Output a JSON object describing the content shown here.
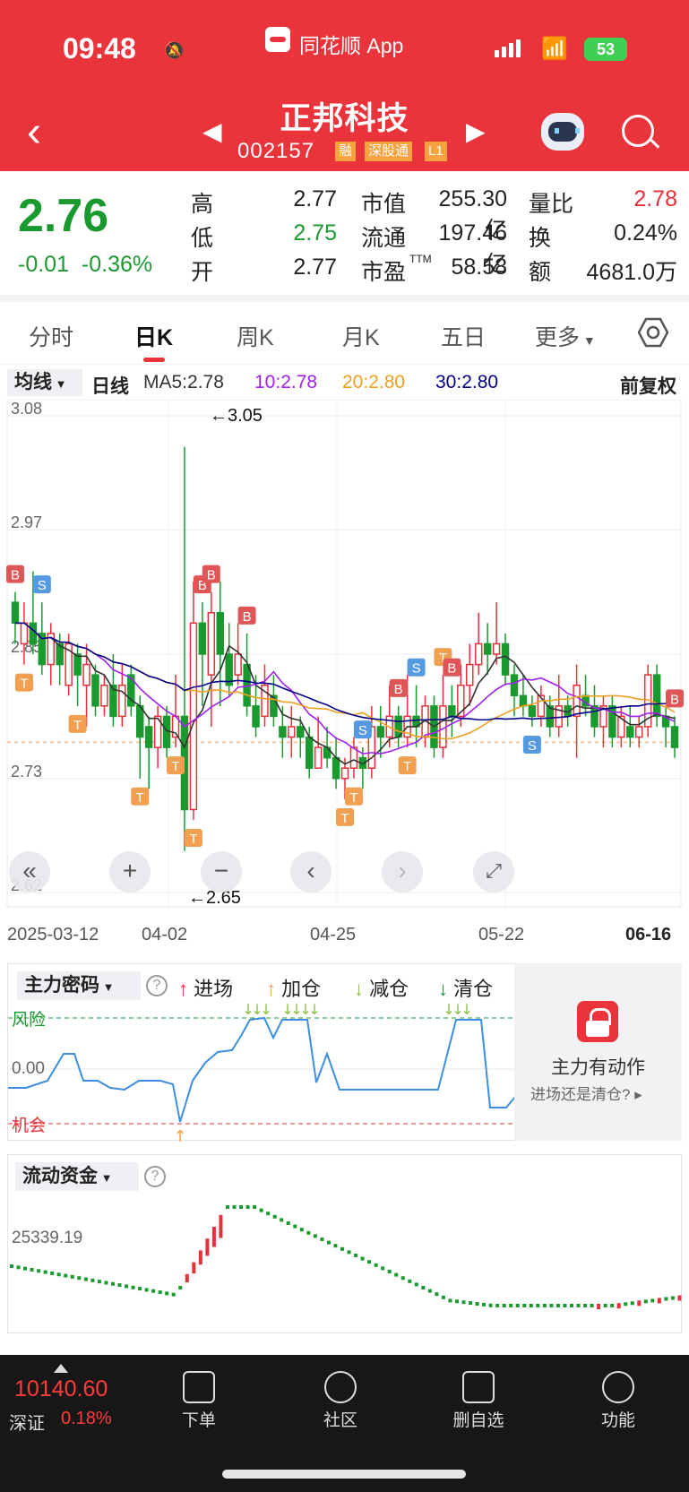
{
  "status_bar": {
    "time": "09:48",
    "app_name": "同花顺 App",
    "battery": "53"
  },
  "header": {
    "name": "正邦科技",
    "code": "002157",
    "tags": [
      "融",
      "深股通",
      "L1"
    ]
  },
  "quote": {
    "price": "2.76",
    "change": "-0.01",
    "change_pct": "-0.36%",
    "fields": [
      {
        "label": "高",
        "value": "2.77",
        "color": "#222222"
      },
      {
        "label": "低",
        "value": "2.75",
        "color": "#1a9a2e"
      },
      {
        "label": "开",
        "value": "2.77",
        "color": "#222222"
      },
      {
        "label": "市值",
        "value": "255.30亿",
        "color": "#222222"
      },
      {
        "label": "流通",
        "value": "197.46亿",
        "color": "#222222"
      },
      {
        "label": "市盈",
        "value": "58.58",
        "color": "#222222"
      },
      {
        "label": "量比",
        "value": "2.78",
        "color": "#e8303a"
      },
      {
        "label": "换",
        "value": "0.24%",
        "color": "#222222"
      },
      {
        "label": "额",
        "value": "4681.0万",
        "color": "#222222"
      }
    ],
    "ttm": "TTM"
  },
  "tabs": [
    "分时",
    "日K",
    "周K",
    "月K",
    "五日",
    "更多"
  ],
  "ma_row": {
    "select": "均线",
    "period": "日线",
    "ma5": "MA5:2.78",
    "ma10": "10:2.78",
    "ma20": "20:2.80",
    "ma30": "30:2.80",
    "adjust": "前复权",
    "colors": {
      "ma5": "#333333",
      "ma10": "#a020f0",
      "ma20": "#f0a020",
      "ma30": "#00008b"
    }
  },
  "chart_data": {
    "type": "candlestick",
    "y_ticks": [
      "3.08",
      "2.97",
      "2.85",
      "2.73",
      "2.62"
    ],
    "ylim": [
      2.62,
      3.08
    ],
    "high_label": "←3.05",
    "low_label": "←2.65",
    "x_labels": [
      "2025-03-12",
      "04-02",
      "04-25",
      "05-22",
      "06-16"
    ],
    "colors": {
      "up": "#e8303a",
      "down": "#1a9a2e",
      "B": "#e05555",
      "S": "#5599e0",
      "T": "#f0a050"
    }
  },
  "indicator": {
    "select": "主力密码",
    "legend": [
      {
        "text": "进场",
        "arrow": "↑",
        "color": "#e8303a"
      },
      {
        "text": "加仓",
        "arrow": "↑",
        "color": "#f0a050"
      },
      {
        "text": "减仓",
        "arrow": "↓",
        "color": "#8fbf3f"
      },
      {
        "text": "清仓",
        "arrow": "↓",
        "color": "#1a9a2e"
      }
    ],
    "risk_label": "风险",
    "zero_label": "0.00",
    "chance_label": "机会",
    "lock_title": "主力有动作",
    "lock_sub": "进场还是清仓?"
  },
  "flow": {
    "select": "流动资金",
    "value_label": "25339.19"
  },
  "bottom": {
    "index_value": "10140.60",
    "index_name": "深证",
    "index_pct": "0.18%",
    "nav": [
      "下单",
      "社区",
      "删自选",
      "功能"
    ]
  }
}
